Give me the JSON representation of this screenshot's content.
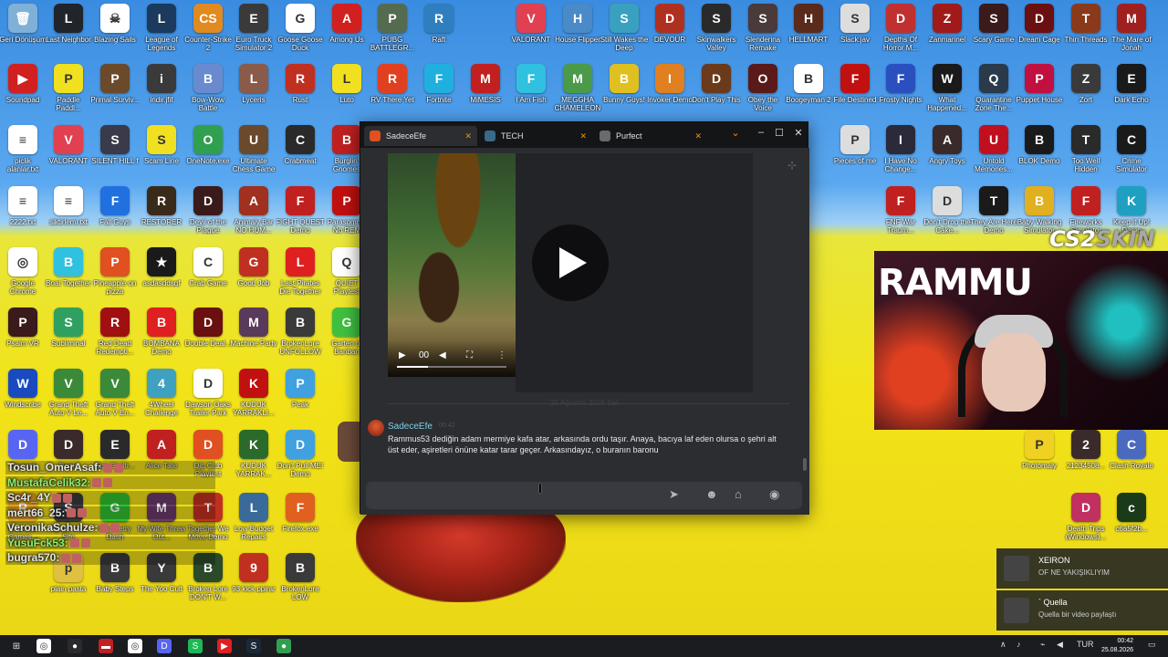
{
  "desktop": {
    "icons": [
      {
        "label": "Geri Dönüşüm",
        "color": "#7fb0d8",
        "glyph": "🗑"
      },
      {
        "label": "Last Neighbor",
        "color": "#20252c",
        "glyph": "L"
      },
      {
        "label": "Blazing Sails",
        "color": "#ffffff",
        "glyph": "☠"
      },
      {
        "label": "League of Legends",
        "color": "#1b3a5e",
        "glyph": "L"
      },
      {
        "label": "Counter-Strike 2",
        "color": "#e08a20",
        "glyph": "CS"
      },
      {
        "label": "Euro Truck Simulator 2",
        "color": "#3a3a3a",
        "glyph": "E"
      },
      {
        "label": "Goose Goose Duck",
        "color": "#ffffff",
        "glyph": "G"
      },
      {
        "label": "Among Us",
        "color": "#d02020",
        "glyph": "A"
      },
      {
        "label": "PUBG BATTLEGR...",
        "color": "#556b4f",
        "glyph": "P"
      },
      {
        "label": "Raft",
        "color": "#2f7fc0",
        "glyph": "R"
      },
      {
        "label": "VALORANT",
        "color": "#e04050",
        "glyph": "V"
      },
      {
        "label": "House Flipper",
        "color": "#4a8ac8",
        "glyph": "H"
      },
      {
        "label": "Still Wakes the Deep",
        "color": "#3aa0c0",
        "glyph": "S"
      },
      {
        "label": "DEVOUR",
        "color": "#b03020",
        "glyph": "D"
      },
      {
        "label": "Skinwalkers Valley",
        "color": "#2a2a2a",
        "glyph": "S"
      },
      {
        "label": "Slenderina Remake",
        "color": "#4a3a3a",
        "glyph": "S"
      },
      {
        "label": "HELLMART",
        "color": "#5a2a1a",
        "glyph": "H"
      },
      {
        "label": "Slack.jav",
        "color": "#dddddd",
        "glyph": "S"
      },
      {
        "label": "Depths Of Horror M...",
        "color": "#c03030",
        "glyph": "D"
      },
      {
        "label": "Zanmarinel",
        "color": "#a01a1a",
        "glyph": "Z"
      },
      {
        "label": "Scary Game",
        "color": "#3a1a1a",
        "glyph": "S"
      },
      {
        "label": "Dream Cage",
        "color": "#6a1010",
        "glyph": "D"
      },
      {
        "label": "Thin Threads",
        "color": "#8a3a1a",
        "glyph": "T"
      },
      {
        "label": "The Mare of Jonah",
        "color": "#a02020",
        "glyph": "M"
      },
      {
        "label": "Soundpad",
        "color": "#d02020",
        "glyph": "▶"
      },
      {
        "label": "Paddle Paddl...",
        "color": "#f0e020",
        "glyph": "P"
      },
      {
        "label": "Primal Surviv...",
        "color": "#6a4a2a",
        "glyph": "P"
      },
      {
        "label": "indir.jfif",
        "color": "#3a3a3a",
        "glyph": "i"
      },
      {
        "label": "Bow-Wow Battle",
        "color": "#6a8ad0",
        "glyph": "B"
      },
      {
        "label": "Lyceris",
        "color": "#8a5a4a",
        "glyph": "L"
      },
      {
        "label": "Rust",
        "color": "#c03020",
        "glyph": "R"
      },
      {
        "label": "Luto",
        "color": "#f0e020",
        "glyph": "L"
      },
      {
        "label": "RV There Yet",
        "color": "#e04020",
        "glyph": "R"
      },
      {
        "label": "Fortnite",
        "color": "#20b0e0",
        "glyph": "F"
      },
      {
        "label": "MiMESIS",
        "color": "#c02020",
        "glyph": "M"
      },
      {
        "label": "I Am Fish",
        "color": "#30c0e0",
        "glyph": "F"
      },
      {
        "label": "MEGGHA CHAMELEON",
        "color": "#4a9a4a",
        "glyph": "M"
      },
      {
        "label": "Bunny Guys!",
        "color": "#e0c020",
        "glyph": "B"
      },
      {
        "label": "Invoker Demo",
        "color": "#e08020",
        "glyph": "I"
      },
      {
        "label": "Don't Play This",
        "color": "#6a3a1a",
        "glyph": "D"
      },
      {
        "label": "Obey the Voice",
        "color": "#5a1a1a",
        "glyph": "O"
      },
      {
        "label": "Boogeyman 2",
        "color": "#ffffff",
        "glyph": "B"
      },
      {
        "label": "File Destined",
        "color": "#c01010",
        "glyph": "F"
      },
      {
        "label": "Frosty Nights",
        "color": "#2a50c0",
        "glyph": "F"
      },
      {
        "label": "What Happened...",
        "color": "#1a1a1a",
        "glyph": "W"
      },
      {
        "label": "Quarantine Zone The...",
        "color": "#2a3a4a",
        "glyph": "Q"
      },
      {
        "label": "Puppet House",
        "color": "#c01040",
        "glyph": "P"
      },
      {
        "label": "Zort",
        "color": "#3a3a3a",
        "glyph": "Z"
      },
      {
        "label": "Dark Echo",
        "color": "#1a1a1a",
        "glyph": "E"
      },
      {
        "label": "piclik alanlar.txt",
        "color": "#ffffff",
        "glyph": "≡"
      },
      {
        "label": "VALORANT",
        "color": "#e04050",
        "glyph": "V"
      },
      {
        "label": "SILENT HILL f",
        "color": "#3a3a4a",
        "glyph": "S"
      },
      {
        "label": "Scam Line",
        "color": "#f0e020",
        "glyph": "S"
      },
      {
        "label": "OneNote.exe",
        "color": "#30a050",
        "glyph": "O"
      },
      {
        "label": "Ultimate Chess Game",
        "color": "#6a4a2a",
        "glyph": "U"
      },
      {
        "label": "Crabmeat",
        "color": "#2a2a2a",
        "glyph": "C"
      },
      {
        "label": "Burglin' Gnomes",
        "color": "#c02020",
        "glyph": "B"
      },
      {
        "label": "Pieces of me",
        "color": "#dddddd",
        "glyph": "P"
      },
      {
        "label": "I Have No Change...",
        "color": "#2a2a3a",
        "glyph": "I"
      },
      {
        "label": "Angry Toys",
        "color": "#3a2a2a",
        "glyph": "A"
      },
      {
        "label": "Untold Memories...",
        "color": "#c01020",
        "glyph": "U"
      },
      {
        "label": "BLOK Demo",
        "color": "#1a1a1a",
        "glyph": "B"
      },
      {
        "label": "Too Well Hidden",
        "color": "#2a2a2a",
        "glyph": "T"
      },
      {
        "label": "Crime Simulator",
        "color": "#1a1a1a",
        "glyph": "C"
      },
      {
        "label": "2222.txt",
        "color": "#ffffff",
        "glyph": "≡"
      },
      {
        "label": "siktirlemi.txt",
        "color": "#ffffff",
        "glyph": "≡"
      },
      {
        "label": "Fall Guys",
        "color": "#2070e0",
        "glyph": "F"
      },
      {
        "label": "RESTORER",
        "color": "#3a2a1a",
        "glyph": "R"
      },
      {
        "label": "Devil of the Plague",
        "color": "#3a1a1a",
        "glyph": "D"
      },
      {
        "label": "Animaly Bar NO HUM...",
        "color": "#a03020",
        "glyph": "A"
      },
      {
        "label": "FIGHT QUEST Demo",
        "color": "#c02020",
        "glyph": "F"
      },
      {
        "label": "Parasomnia No REM",
        "color": "#c01010",
        "glyph": "P"
      },
      {
        "label": "FNF War Traum...",
        "color": "#c02020",
        "glyph": "F"
      },
      {
        "label": "Don't Drop the Cake...",
        "color": "#dddddd",
        "glyph": "D"
      },
      {
        "label": "They Are Here Demo",
        "color": "#1a1a1a",
        "glyph": "T"
      },
      {
        "label": "Baby Walking Simulator",
        "color": "#e0b020",
        "glyph": "B"
      },
      {
        "label": "Fireworks Simulator",
        "color": "#c02020",
        "glyph": "F"
      },
      {
        "label": "Keep It Up! Demo",
        "color": "#20a0c0",
        "glyph": "K"
      },
      {
        "label": "Google Chrome",
        "color": "#ffffff",
        "glyph": "◎"
      },
      {
        "label": "Boat Together",
        "color": "#30c0e0",
        "glyph": "B"
      },
      {
        "label": "Pineapple on pizza",
        "color": "#e05020",
        "glyph": "P"
      },
      {
        "label": "asdasddsgf",
        "color": "#1a1a1a",
        "glyph": "★"
      },
      {
        "label": "Crab Game",
        "color": "#ffffff",
        "glyph": "C"
      },
      {
        "label": "Good Job",
        "color": "#c03020",
        "glyph": "G"
      },
      {
        "label": "Last Pirates Die Together",
        "color": "#e02020",
        "glyph": "L"
      },
      {
        "label": "QUIET Playtest",
        "color": "#ffffff",
        "glyph": "Q"
      },
      {
        "label": "Psalm VR",
        "color": "#3a1a1a",
        "glyph": "P"
      },
      {
        "label": "Subliminal",
        "color": "#30a060",
        "glyph": "S"
      },
      {
        "label": "Red Dead Redempti...",
        "color": "#a01010",
        "glyph": "R"
      },
      {
        "label": "BOMBANA Demo",
        "color": "#e02020",
        "glyph": "B"
      },
      {
        "label": "Double Deal...",
        "color": "#6a1010",
        "glyph": "D"
      },
      {
        "label": "Machine Party",
        "color": "#5a3a5a",
        "glyph": "M"
      },
      {
        "label": "BrokenLore UNFOLLOW",
        "color": "#3a3a3a",
        "glyph": "B"
      },
      {
        "label": "Garten of Banban",
        "color": "#40c040",
        "glyph": "G"
      },
      {
        "label": "Windscribe",
        "color": "#1a4ac0",
        "glyph": "W"
      },
      {
        "label": "Grand Theft Auto V Le...",
        "color": "#3a8a3a",
        "glyph": "V"
      },
      {
        "label": "Grand Theft Auto V En...",
        "color": "#3a8a3a",
        "glyph": "V"
      },
      {
        "label": "4Wheel Challenge",
        "color": "#40a0c0",
        "glyph": "4"
      },
      {
        "label": "Dawson Oaks Trailer Park",
        "color": "#ffffff",
        "glyph": "D"
      },
      {
        "label": "KUDUK YARRAKLI...",
        "color": "#c01010",
        "glyph": "K"
      },
      {
        "label": "Peak",
        "color": "#40a0e0",
        "glyph": "P"
      },
      {
        "label": "Discord",
        "color": "#5865f2",
        "glyph": "D"
      },
      {
        "label": "Demo",
        "color": "#3a2a2a",
        "glyph": "D"
      },
      {
        "label": "Egg Sheltr...",
        "color": "#2a2a2a",
        "glyph": "E"
      },
      {
        "label": "Alice Tate",
        "color": "#c02020",
        "glyph": "A"
      },
      {
        "label": "Dip Club Playtest",
        "color": "#e05020",
        "glyph": "D"
      },
      {
        "label": "KUDUK YARRAK...",
        "color": "#2a6a2a",
        "glyph": "K"
      },
      {
        "label": "Don't Pull ME! Demo",
        "color": "#40a0e0",
        "glyph": "D"
      },
      {
        "label": "Rockstar Games...",
        "color": "#e0a020",
        "glyph": "R"
      },
      {
        "label": "Spider Fox Site",
        "color": "#3a3a3a",
        "glyph": "S"
      },
      {
        "label": "Geometry Dash",
        "color": "#30c030",
        "glyph": "G"
      },
      {
        "label": "My Wife Threw Out...",
        "color": "#6a3a6a",
        "glyph": "M"
      },
      {
        "label": "Together We Move Demo",
        "color": "#c03020",
        "glyph": "T"
      },
      {
        "label": "Low Budget Repairs",
        "color": "#3a6a9a",
        "glyph": "L"
      },
      {
        "label": "Firefox.exe",
        "color": "#e06020",
        "glyph": "F"
      },
      {
        "label": "plain pasta",
        "color": "#e0c040",
        "glyph": "p"
      },
      {
        "label": "Baby Steps",
        "color": "#3a3a3a",
        "glyph": "B"
      },
      {
        "label": "The Yoo Cult",
        "color": "#3a3a3a",
        "glyph": "Y"
      },
      {
        "label": "Broken Lore DON'T W...",
        "color": "#2a4a2a",
        "glyph": "B"
      },
      {
        "label": "93 kick ppirar",
        "color": "#c03020",
        "glyph": "9"
      },
      {
        "label": "BrokenLore LOW",
        "color": "#3a3a3a",
        "glyph": "B"
      },
      {
        "label": "Photomaly",
        "color": "#f0d020",
        "glyph": "P"
      },
      {
        "label": "21234508... ",
        "color": "#3a2a2a",
        "glyph": "2"
      },
      {
        "label": "Clash Royale",
        "color": "#4a6ac0",
        "glyph": "C"
      },
      {
        "label": "Death Trips (Windows)...",
        "color": "#c03060",
        "glyph": "D"
      },
      {
        "label": "c6a5f2b...",
        "color": "#1a3a1a",
        "glyph": "c"
      },
      {
        "label": "Roblox Studio",
        "color": "#3a3a3a",
        "glyph": "R"
      }
    ]
  },
  "stream_chat": [
    {
      "user": "Tosun_OmerAsaf:",
      "class": ""
    },
    {
      "user": "MustafaCelik32:",
      "class": "green"
    },
    {
      "user": "Sc4r_4Y",
      "class": ""
    },
    {
      "user": "mert66_25:",
      "class": ""
    },
    {
      "user": "VeronikaSchulze:",
      "class": ""
    },
    {
      "user": "YusuFck53:",
      "class": "green"
    },
    {
      "user": "bugra570:",
      "class": ""
    }
  ],
  "window": {
    "tabs": [
      {
        "label": "SadeceEfe",
        "color": "#e05020"
      },
      {
        "label": "TECH",
        "color": "#3a6a8a"
      },
      {
        "label": "Purfect",
        "color": "#6a6a6a"
      }
    ],
    "video": {
      "time": "00"
    },
    "date_separator": "25 Ağustos 2026 Salı",
    "message": {
      "author": "SadeceEfe",
      "time": "00:42",
      "text": "Rammus53 dediğin adam mermiye kafa atar, arkasında ordu taşır. Anaya, bacıya laf eden olursa o şehri alt üst eder, aşiretleri önüne katar tarar geçer. Arkasındayız, o buranın baronu"
    },
    "input": {
      "placeholder": ""
    }
  },
  "overlay": {
    "brand_main": "CS2",
    "brand_sub": "SKIN",
    "cam_text": "RAMMU"
  },
  "notifications": [
    {
      "title": "XEIRON",
      "text": "OF NE YAKIŞIKLIYIM"
    },
    {
      "title": "` Quella",
      "text": "Quella bir video paylaştı"
    }
  ],
  "taskbar": {
    "apps": [
      {
        "name": "chrome-taskbar-icon",
        "color": "#ffffff",
        "glyph": "◎"
      },
      {
        "name": "obs-taskbar-icon",
        "color": "#2a2a2a",
        "glyph": "●"
      },
      {
        "name": "app-red-taskbar-icon",
        "color": "#c02020",
        "glyph": "▬"
      },
      {
        "name": "chrome2-taskbar-icon",
        "color": "#ffffff",
        "glyph": "◎"
      },
      {
        "name": "discord-taskbar-icon",
        "color": "#5865f2",
        "glyph": "D"
      },
      {
        "name": "spotify-taskbar-icon",
        "color": "#1db954",
        "glyph": "S"
      },
      {
        "name": "youtube-taskbar-icon",
        "color": "#e02020",
        "glyph": "▶"
      },
      {
        "name": "steam-taskbar-icon",
        "color": "#1b2838",
        "glyph": "S"
      },
      {
        "name": "app-green-taskbar-icon",
        "color": "#30a050",
        "glyph": "●"
      }
    ],
    "language": "TUR",
    "time": "00:42",
    "date": "25.08.2026"
  }
}
